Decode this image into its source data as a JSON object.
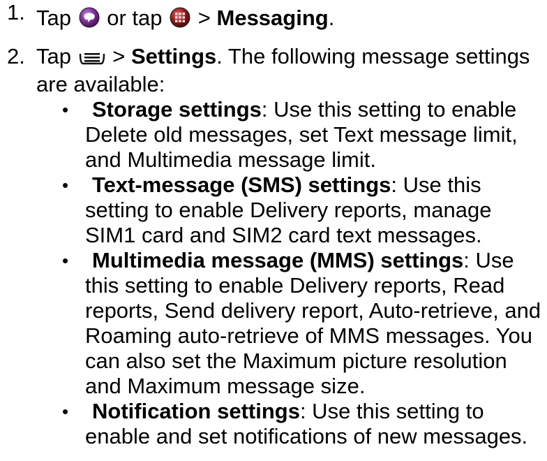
{
  "steps": [
    {
      "number": "1.",
      "text_a": "Tap",
      "icon_a": "messaging-app-icon",
      "text_b": "or tap",
      "icon_b": "all-apps-icon",
      "text_c": ">",
      "bold": "Messaging",
      "text_d": "."
    },
    {
      "number": "2.",
      "text_a": "Tap",
      "icon_a": "menu-key-icon",
      "text_b": ">",
      "bold": "Settings",
      "text_c": ". The following message settings are available:"
    }
  ],
  "settings": [
    {
      "bullet": "•",
      "title": "Storage settings",
      "desc": ": Use this setting to enable Delete old messages, set Text message limit, and Multimedia message limit."
    },
    {
      "bullet": "•",
      "title": "Text-message (SMS) settings",
      "desc": ": Use this setting to enable Delivery reports, manage SIM1 card and SIM2 card text messages."
    },
    {
      "bullet": "•",
      "title": "Multimedia message (MMS) settings",
      "desc": ": Use this setting to enable Delivery reports, Read reports, Send delivery report, Auto-retrieve, and Roaming auto-retrieve of MMS messages. You can also set the Maximum picture resolution and Maximum message size."
    },
    {
      "bullet": "•",
      "title": "Notification settings",
      "desc": ": Use this setting to enable and set notifications of new messages."
    }
  ],
  "colors": {
    "messaging_icon": "#5a1f73",
    "apps_icon": "#7a1414",
    "menu_icon": "#111111"
  }
}
